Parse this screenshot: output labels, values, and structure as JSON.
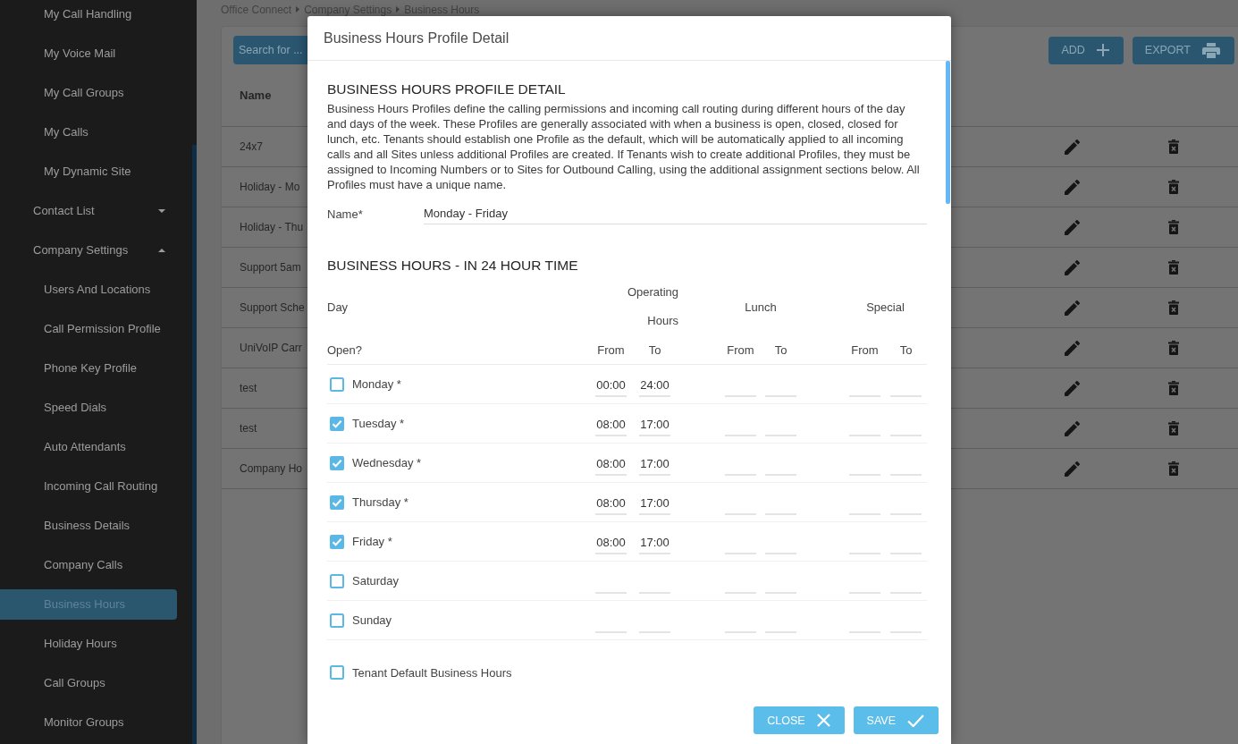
{
  "sidebar": {
    "items": [
      {
        "children": [
          {
            "label": "My Call Handling",
            "selected": false
          },
          {
            "label": "My Voice Mail",
            "selected": false
          },
          {
            "label": "My Call Groups",
            "selected": false
          },
          {
            "label": "My Calls",
            "selected": false
          },
          {
            "label": "My Dynamic Site",
            "selected": false
          }
        ]
      },
      {
        "label": "Contact List",
        "expanded": false
      },
      {
        "label": "Company Settings",
        "expanded": true,
        "children": [
          {
            "label": "Users And Locations",
            "selected": false
          },
          {
            "label": "Call Permission Profile",
            "selected": false
          },
          {
            "label": "Phone Key Profile",
            "selected": false
          },
          {
            "label": "Speed Dials",
            "selected": false
          },
          {
            "label": "Auto Attendants",
            "selected": false
          },
          {
            "label": "Incoming Call Routing",
            "selected": false
          },
          {
            "label": "Business Details",
            "selected": false
          },
          {
            "label": "Company Calls",
            "selected": false
          },
          {
            "label": "Business Hours",
            "selected": true
          },
          {
            "label": "Holiday Hours",
            "selected": false
          },
          {
            "label": "Call Groups",
            "selected": false
          },
          {
            "label": "Monitor Groups",
            "selected": false
          }
        ]
      }
    ]
  },
  "breadcrumb": [
    "Office Connect",
    "Company Settings",
    "Business Hours"
  ],
  "toolbar": {
    "search": {
      "placeholder": "Search for ..."
    },
    "buttons": [
      {
        "label": "ADD",
        "kind": "add"
      },
      {
        "label": "EXPORT",
        "kind": "export"
      }
    ]
  },
  "table": {
    "columns": [
      "Name"
    ],
    "rows": [
      {
        "name": "24x7"
      },
      {
        "name": "Holiday - Mo"
      },
      {
        "name": "Holiday - Thu"
      },
      {
        "name": "Support 5am"
      },
      {
        "name": "Support Sche"
      },
      {
        "name": "UniVoIP Carr"
      },
      {
        "name": "test"
      },
      {
        "name": "test"
      },
      {
        "name": "Company Ho"
      }
    ]
  },
  "dialog": {
    "title": "Business Hours Profile Detail",
    "heading": "BUSINESS HOURS PROFILE DETAIL",
    "description": "Business Hours Profiles define the calling permissions and incoming call routing during different hours of the day and days of the week. These Profiles are generally associated with when a business is open, closed, closed for lunch, etc. Tenants should establish one Profile as the default, which will be automatically applied to all incoming calls and all Sites unless additional Profiles are created. If Tenants wish to create additional Profiles, they must be assigned to Incoming Numbers or to Sites for Outbound Calling, using the additional assignment sections below. All Profiles must have a unique name.",
    "name_field": {
      "label": "Name*",
      "value": "Monday - Friday"
    },
    "hours": {
      "heading": "BUSINESS HOURS - IN 24 HOUR TIME",
      "day_label": "Day",
      "open_label": "Open?",
      "column_groups": [
        "Operating Hours",
        "Lunch",
        "Special"
      ],
      "subcolumns": [
        "From",
        "To",
        "From",
        "To",
        "From",
        "To"
      ],
      "days": [
        {
          "label": "Monday *",
          "checked": false,
          "operating_from": "00:00",
          "operating_to": "24:00"
        },
        {
          "label": "Tuesday *",
          "checked": true,
          "operating_from": "08:00",
          "operating_to": "17:00"
        },
        {
          "label": "Wednesday *",
          "checked": true,
          "operating_from": "08:00",
          "operating_to": "17:00"
        },
        {
          "label": "Thursday *",
          "checked": true,
          "operating_from": "08:00",
          "operating_to": "17:00"
        },
        {
          "label": "Friday *",
          "checked": true,
          "operating_from": "08:00",
          "operating_to": "17:00"
        },
        {
          "label": "Saturday",
          "checked": false
        },
        {
          "label": "Sunday",
          "checked": false
        }
      ]
    },
    "tenant_default": {
      "label": "Tenant Default Business Hours",
      "checked": false
    },
    "buttons": [
      {
        "label": "CLOSE",
        "kind": "close"
      },
      {
        "label": "SAVE",
        "kind": "save"
      }
    ]
  }
}
